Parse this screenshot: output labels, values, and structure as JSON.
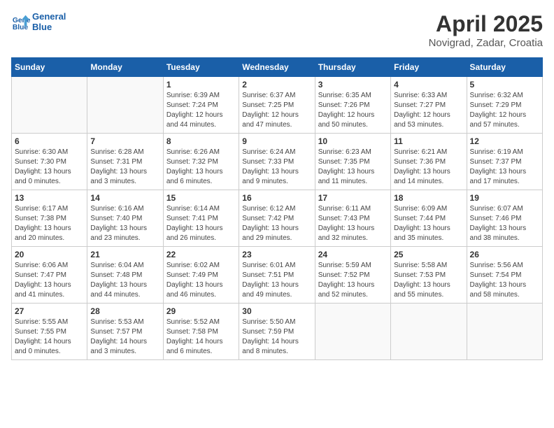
{
  "header": {
    "logo_line1": "General",
    "logo_line2": "Blue",
    "month_year": "April 2025",
    "location": "Novigrad, Zadar, Croatia"
  },
  "weekdays": [
    "Sunday",
    "Monday",
    "Tuesday",
    "Wednesday",
    "Thursday",
    "Friday",
    "Saturday"
  ],
  "weeks": [
    [
      {
        "day": "",
        "sunrise": "",
        "sunset": "",
        "daylight": "",
        "empty": true
      },
      {
        "day": "",
        "sunrise": "",
        "sunset": "",
        "daylight": "",
        "empty": true
      },
      {
        "day": "1",
        "sunrise": "Sunrise: 6:39 AM",
        "sunset": "Sunset: 7:24 PM",
        "daylight": "Daylight: 12 hours and 44 minutes.",
        "empty": false
      },
      {
        "day": "2",
        "sunrise": "Sunrise: 6:37 AM",
        "sunset": "Sunset: 7:25 PM",
        "daylight": "Daylight: 12 hours and 47 minutes.",
        "empty": false
      },
      {
        "day": "3",
        "sunrise": "Sunrise: 6:35 AM",
        "sunset": "Sunset: 7:26 PM",
        "daylight": "Daylight: 12 hours and 50 minutes.",
        "empty": false
      },
      {
        "day": "4",
        "sunrise": "Sunrise: 6:33 AM",
        "sunset": "Sunset: 7:27 PM",
        "daylight": "Daylight: 12 hours and 53 minutes.",
        "empty": false
      },
      {
        "day": "5",
        "sunrise": "Sunrise: 6:32 AM",
        "sunset": "Sunset: 7:29 PM",
        "daylight": "Daylight: 12 hours and 57 minutes.",
        "empty": false
      }
    ],
    [
      {
        "day": "6",
        "sunrise": "Sunrise: 6:30 AM",
        "sunset": "Sunset: 7:30 PM",
        "daylight": "Daylight: 13 hours and 0 minutes.",
        "empty": false
      },
      {
        "day": "7",
        "sunrise": "Sunrise: 6:28 AM",
        "sunset": "Sunset: 7:31 PM",
        "daylight": "Daylight: 13 hours and 3 minutes.",
        "empty": false
      },
      {
        "day": "8",
        "sunrise": "Sunrise: 6:26 AM",
        "sunset": "Sunset: 7:32 PM",
        "daylight": "Daylight: 13 hours and 6 minutes.",
        "empty": false
      },
      {
        "day": "9",
        "sunrise": "Sunrise: 6:24 AM",
        "sunset": "Sunset: 7:33 PM",
        "daylight": "Daylight: 13 hours and 9 minutes.",
        "empty": false
      },
      {
        "day": "10",
        "sunrise": "Sunrise: 6:23 AM",
        "sunset": "Sunset: 7:35 PM",
        "daylight": "Daylight: 13 hours and 11 minutes.",
        "empty": false
      },
      {
        "day": "11",
        "sunrise": "Sunrise: 6:21 AM",
        "sunset": "Sunset: 7:36 PM",
        "daylight": "Daylight: 13 hours and 14 minutes.",
        "empty": false
      },
      {
        "day": "12",
        "sunrise": "Sunrise: 6:19 AM",
        "sunset": "Sunset: 7:37 PM",
        "daylight": "Daylight: 13 hours and 17 minutes.",
        "empty": false
      }
    ],
    [
      {
        "day": "13",
        "sunrise": "Sunrise: 6:17 AM",
        "sunset": "Sunset: 7:38 PM",
        "daylight": "Daylight: 13 hours and 20 minutes.",
        "empty": false
      },
      {
        "day": "14",
        "sunrise": "Sunrise: 6:16 AM",
        "sunset": "Sunset: 7:40 PM",
        "daylight": "Daylight: 13 hours and 23 minutes.",
        "empty": false
      },
      {
        "day": "15",
        "sunrise": "Sunrise: 6:14 AM",
        "sunset": "Sunset: 7:41 PM",
        "daylight": "Daylight: 13 hours and 26 minutes.",
        "empty": false
      },
      {
        "day": "16",
        "sunrise": "Sunrise: 6:12 AM",
        "sunset": "Sunset: 7:42 PM",
        "daylight": "Daylight: 13 hours and 29 minutes.",
        "empty": false
      },
      {
        "day": "17",
        "sunrise": "Sunrise: 6:11 AM",
        "sunset": "Sunset: 7:43 PM",
        "daylight": "Daylight: 13 hours and 32 minutes.",
        "empty": false
      },
      {
        "day": "18",
        "sunrise": "Sunrise: 6:09 AM",
        "sunset": "Sunset: 7:44 PM",
        "daylight": "Daylight: 13 hours and 35 minutes.",
        "empty": false
      },
      {
        "day": "19",
        "sunrise": "Sunrise: 6:07 AM",
        "sunset": "Sunset: 7:46 PM",
        "daylight": "Daylight: 13 hours and 38 minutes.",
        "empty": false
      }
    ],
    [
      {
        "day": "20",
        "sunrise": "Sunrise: 6:06 AM",
        "sunset": "Sunset: 7:47 PM",
        "daylight": "Daylight: 13 hours and 41 minutes.",
        "empty": false
      },
      {
        "day": "21",
        "sunrise": "Sunrise: 6:04 AM",
        "sunset": "Sunset: 7:48 PM",
        "daylight": "Daylight: 13 hours and 44 minutes.",
        "empty": false
      },
      {
        "day": "22",
        "sunrise": "Sunrise: 6:02 AM",
        "sunset": "Sunset: 7:49 PM",
        "daylight": "Daylight: 13 hours and 46 minutes.",
        "empty": false
      },
      {
        "day": "23",
        "sunrise": "Sunrise: 6:01 AM",
        "sunset": "Sunset: 7:51 PM",
        "daylight": "Daylight: 13 hours and 49 minutes.",
        "empty": false
      },
      {
        "day": "24",
        "sunrise": "Sunrise: 5:59 AM",
        "sunset": "Sunset: 7:52 PM",
        "daylight": "Daylight: 13 hours and 52 minutes.",
        "empty": false
      },
      {
        "day": "25",
        "sunrise": "Sunrise: 5:58 AM",
        "sunset": "Sunset: 7:53 PM",
        "daylight": "Daylight: 13 hours and 55 minutes.",
        "empty": false
      },
      {
        "day": "26",
        "sunrise": "Sunrise: 5:56 AM",
        "sunset": "Sunset: 7:54 PM",
        "daylight": "Daylight: 13 hours and 58 minutes.",
        "empty": false
      }
    ],
    [
      {
        "day": "27",
        "sunrise": "Sunrise: 5:55 AM",
        "sunset": "Sunset: 7:55 PM",
        "daylight": "Daylight: 14 hours and 0 minutes.",
        "empty": false
      },
      {
        "day": "28",
        "sunrise": "Sunrise: 5:53 AM",
        "sunset": "Sunset: 7:57 PM",
        "daylight": "Daylight: 14 hours and 3 minutes.",
        "empty": false
      },
      {
        "day": "29",
        "sunrise": "Sunrise: 5:52 AM",
        "sunset": "Sunset: 7:58 PM",
        "daylight": "Daylight: 14 hours and 6 minutes.",
        "empty": false
      },
      {
        "day": "30",
        "sunrise": "Sunrise: 5:50 AM",
        "sunset": "Sunset: 7:59 PM",
        "daylight": "Daylight: 14 hours and 8 minutes.",
        "empty": false
      },
      {
        "day": "",
        "sunrise": "",
        "sunset": "",
        "daylight": "",
        "empty": true
      },
      {
        "day": "",
        "sunrise": "",
        "sunset": "",
        "daylight": "",
        "empty": true
      },
      {
        "day": "",
        "sunrise": "",
        "sunset": "",
        "daylight": "",
        "empty": true
      }
    ]
  ]
}
